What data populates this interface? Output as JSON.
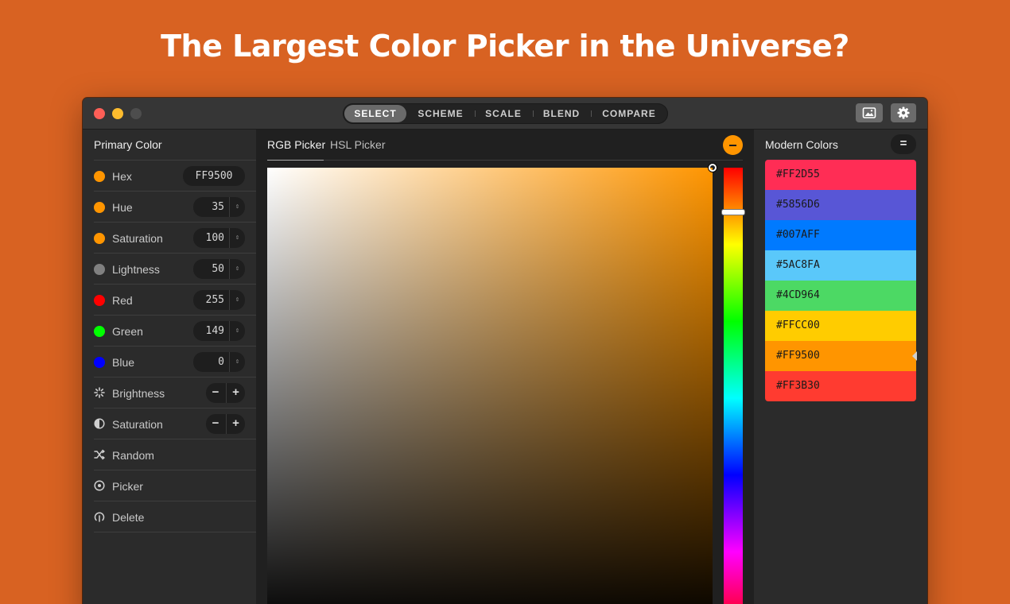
{
  "headline": "The Largest Color Picker in the Universe?",
  "toolbar": {
    "segments": [
      "SELECT",
      "SCHEME",
      "SCALE",
      "BLEND",
      "COMPARE"
    ],
    "active_segment": "SELECT",
    "image_button_icon": "image-icon",
    "settings_button_icon": "gear-icon"
  },
  "sidebar": {
    "title": "Primary Color",
    "hex": {
      "label": "Hex",
      "value": "FF9500",
      "color": "#FF9500"
    },
    "hue": {
      "label": "Hue",
      "value": "35",
      "color": "#FF9500"
    },
    "saturation": {
      "label": "Saturation",
      "value": "100",
      "color": "#FF9500"
    },
    "lightness": {
      "label": "Lightness",
      "value": "50",
      "color": "#808080"
    },
    "red": {
      "label": "Red",
      "value": "255",
      "color": "#FF0000"
    },
    "green": {
      "label": "Green",
      "value": "149",
      "color": "#00FF00"
    },
    "blue": {
      "label": "Blue",
      "value": "0",
      "color": "#0000FF"
    },
    "brightness_label": "Brightness",
    "saturation_adjust_label": "Saturation",
    "random_label": "Random",
    "picker_label": "Picker",
    "delete_label": "Delete"
  },
  "center": {
    "tabs": [
      "RGB Picker",
      "HSL Picker"
    ],
    "active_tab": "RGB Picker",
    "current_color": "#FF9500"
  },
  "palette": {
    "title": "Modern Colors",
    "menu_icon": "equals-icon",
    "selected": "#FF9500",
    "colors": [
      "#FF2D55",
      "#5856D6",
      "#007AFF",
      "#5AC8FA",
      "#4CD964",
      "#FFCC00",
      "#FF9500",
      "#FF3B30"
    ]
  }
}
